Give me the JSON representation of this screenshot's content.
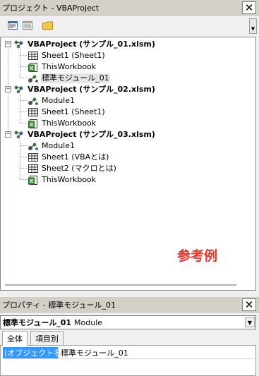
{
  "project_window": {
    "title": "プロジェクト - VBAProject",
    "close_label": "✕"
  },
  "toolbar": {
    "buttons": [
      {
        "name": "view-code-icon"
      },
      {
        "name": "view-object-icon"
      },
      {
        "name": "toggle-folders-icon"
      }
    ]
  },
  "tree": {
    "projects": [
      {
        "label": "VBAProject (サンプル_01.xlsm)",
        "children": [
          {
            "label": "Sheet1 (Sheet1)",
            "icon": "sheet-icon"
          },
          {
            "label": "ThisWorkbook",
            "icon": "workbook-icon"
          },
          {
            "label": "標準モジュール_01",
            "icon": "module-icon",
            "selected": true
          }
        ]
      },
      {
        "label": "VBAProject (サンプル_02.xlsm)",
        "children": [
          {
            "label": "Module1",
            "icon": "module-icon"
          },
          {
            "label": "Sheet1 (Sheet1)",
            "icon": "sheet-icon"
          },
          {
            "label": "ThisWorkbook",
            "icon": "workbook-icon"
          }
        ]
      },
      {
        "label": "VBAProject (サンプル_03.xlsm)",
        "children": [
          {
            "label": "Module1",
            "icon": "module-icon"
          },
          {
            "label": "Sheet1 (VBAとは)",
            "icon": "sheet-icon"
          },
          {
            "label": "Sheet2 (マクロとは)",
            "icon": "sheet-icon"
          },
          {
            "label": "ThisWorkbook",
            "icon": "workbook-icon"
          }
        ]
      }
    ],
    "annotation": "参考例"
  },
  "properties_window": {
    "title": "プロパティ - 標準モジュール_01",
    "close_label": "✕",
    "object_name": "標準モジュール_01",
    "object_type": "Module",
    "tabs": [
      "全体",
      "項目別"
    ],
    "rows": [
      {
        "name": "(オブジェクト名)",
        "value": "標準モジュール_01"
      }
    ]
  },
  "colors": {
    "annotation": "#e8352b",
    "selection": "#3399ff"
  }
}
